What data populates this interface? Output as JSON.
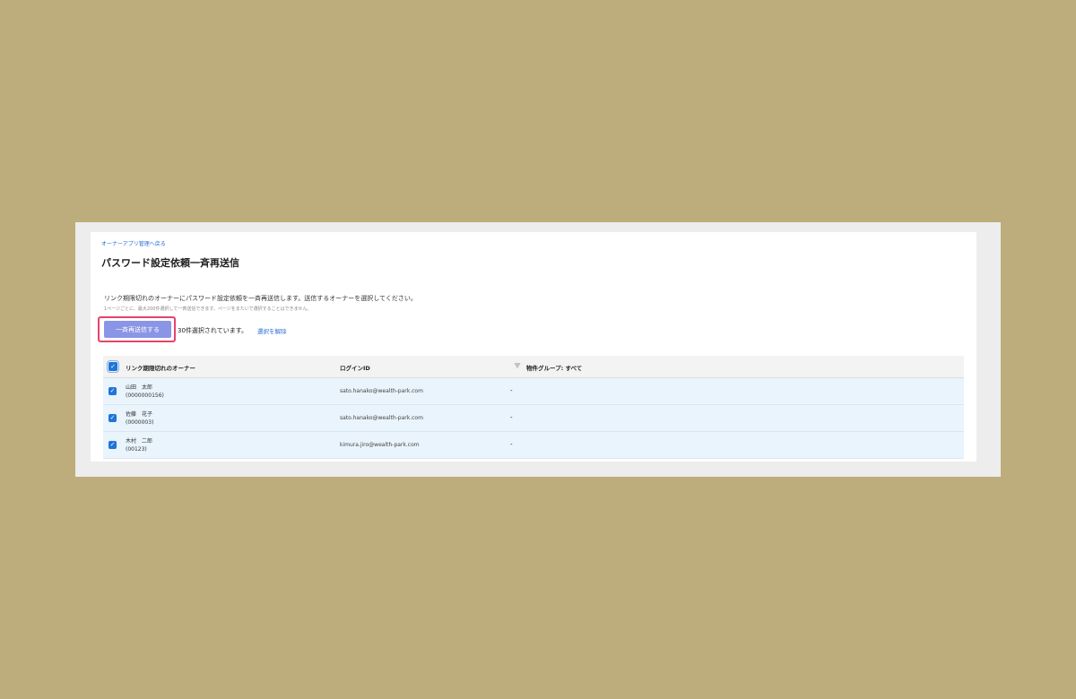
{
  "header": {
    "back_link": "オーナーアプリ管理へ戻る",
    "title": "パスワード設定依頼一斉再送信"
  },
  "description": {
    "main": "リンク期限切れのオーナーにパスワード設定依頼を一斉再送信します。送信するオーナーを選択してください。",
    "note": "1ページごとに、最大200件選択して一斉送信できます。ページをまたいで選択することはできません。"
  },
  "actions": {
    "send_button": "一斉再送信する",
    "selected_count": "30件選択されています。",
    "clear_selection": "選択を解除"
  },
  "table": {
    "columns": {
      "owner": "リンク期限切れのオーナー",
      "login_id": "ログインID",
      "group": "物件グループ: すべて"
    },
    "rows": [
      {
        "checked": "✓",
        "name": "山田　太郎",
        "id": "(0000000156)",
        "login": "sato.hanako@wealth-park.com",
        "group": "-"
      },
      {
        "checked": "✓",
        "name": "佐藤　花子",
        "id": "(0000003)",
        "login": "sato.hanako@wealth-park.com",
        "group": "-"
      },
      {
        "checked": "✓",
        "name": "木村　二郎",
        "id": "(00123)",
        "login": "kimura.jiro@wealth-park.com",
        "group": "-"
      }
    ]
  },
  "colors": {
    "background": "#bead7c",
    "accent": "#1f75d8",
    "button": "#8b95e6",
    "highlight": "#e6436d",
    "row_selected": "#e9f4fc"
  },
  "icons": {
    "checkbox": "checkbox-checked-icon",
    "filter": "filter-icon"
  }
}
